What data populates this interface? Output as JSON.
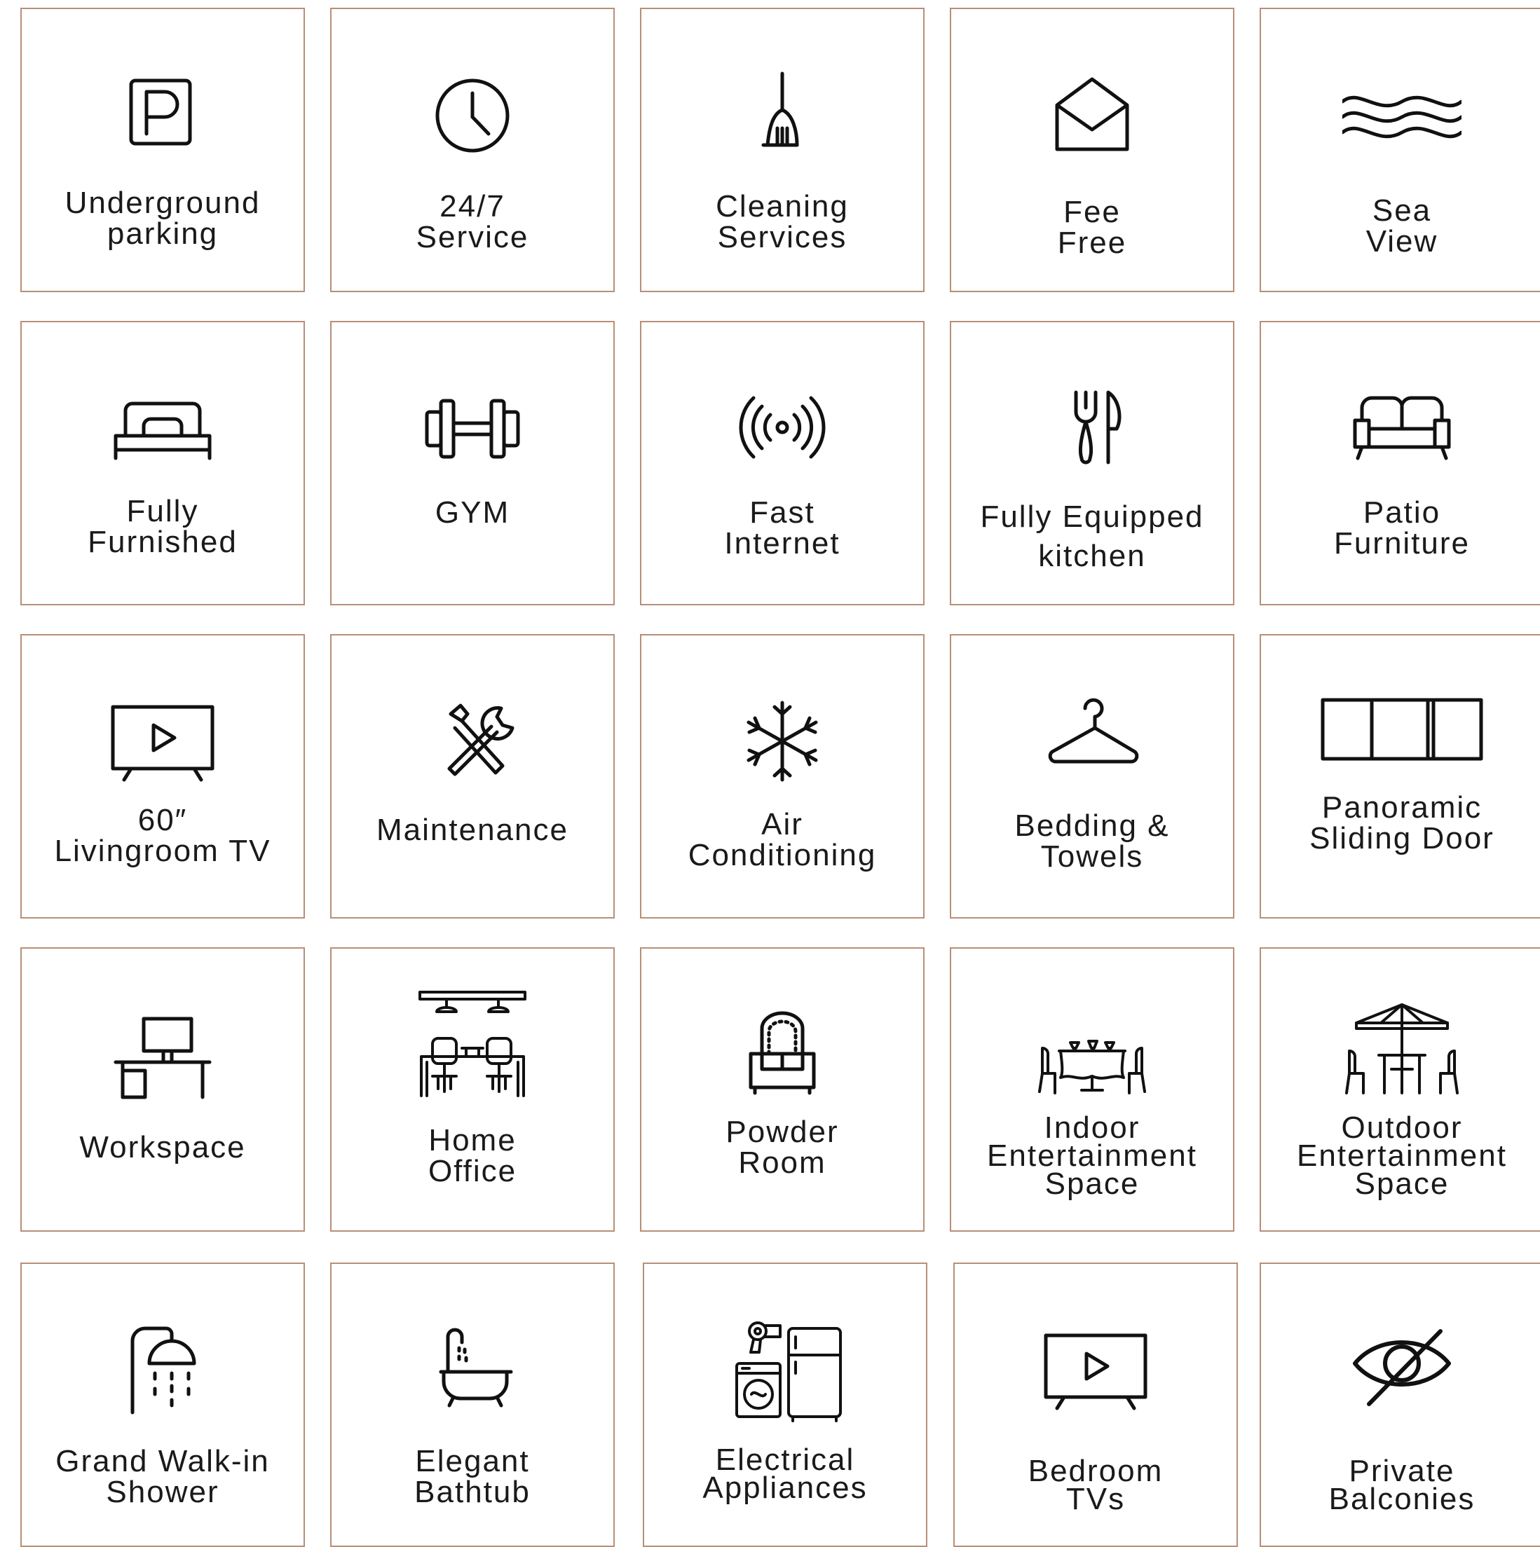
{
  "colors": {
    "tile_border": "#b88f78",
    "icon_stroke": "#111111",
    "label_text": "#1a1a1a"
  },
  "amenities": [
    {
      "label": "Underground\nparking",
      "icon": "parking-icon"
    },
    {
      "label": "24/7\nService",
      "icon": "clock-icon"
    },
    {
      "label": "Cleaning\nServices",
      "icon": "broom-icon"
    },
    {
      "label": "Fee\nFree",
      "icon": "envelope-icon"
    },
    {
      "label": "Sea\nView",
      "icon": "waves-icon"
    },
    {
      "label": "Fully\nFurnished",
      "icon": "bed-icon"
    },
    {
      "label": "GYM",
      "icon": "dumbbell-icon"
    },
    {
      "label": "Fast\nInternet",
      "icon": "wireless-signal-icon"
    },
    {
      "label": "Fully Equipped\nkitchen",
      "icon": "fork-knife-icon"
    },
    {
      "label": "Patio\nFurniture",
      "icon": "sofa-icon"
    },
    {
      "label": "60″\nLivingroom TV",
      "icon": "tv-icon"
    },
    {
      "label": "Maintenance",
      "icon": "tools-icon"
    },
    {
      "label": "Air\nConditioning",
      "icon": "snowflake-icon"
    },
    {
      "label": "Bedding &\nTowels",
      "icon": "hanger-icon"
    },
    {
      "label": "Panoramic\nSliding Door",
      "icon": "sliding-door-icon"
    },
    {
      "label": "Workspace",
      "icon": "desk-computer-icon"
    },
    {
      "label": "Home\nOffice",
      "icon": "office-desks-icon"
    },
    {
      "label": "Powder\nRoom",
      "icon": "vanity-icon"
    },
    {
      "label": "Indoor\nEntertainment\nSpace",
      "icon": "dining-table-icon"
    },
    {
      "label": "Outdoor\nEntertainment\nSpace",
      "icon": "patio-umbrella-icon"
    },
    {
      "label": "Grand Walk-in\nShower",
      "icon": "shower-icon"
    },
    {
      "label": "Elegant\nBathtub",
      "icon": "bathtub-icon"
    },
    {
      "label": "Electrical\nAppliances",
      "icon": "appliances-icon"
    },
    {
      "label": "Bedroom\nTVs",
      "icon": "bedroom-tv-icon"
    },
    {
      "label": "Private\nBalconies",
      "icon": "eye-slash-icon"
    }
  ]
}
